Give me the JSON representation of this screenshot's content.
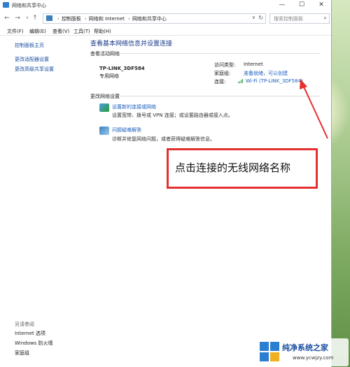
{
  "window": {
    "title": "网络和共享中心"
  },
  "controls": {
    "minimize": "—",
    "maximize": "☐",
    "close": "✕"
  },
  "nav": {
    "back": "←",
    "forward": "→",
    "recent": "∨",
    "up": "↑"
  },
  "address": {
    "crumbs": [
      "控制面板",
      "网络和 Internet",
      "网络和共享中心"
    ],
    "search_placeholder": "搜索控制面板"
  },
  "menu": [
    "文件(F)",
    "编辑(E)",
    "查看(V)",
    "工具(T)",
    "帮助(H)"
  ],
  "sidebar": {
    "links": [
      "控制面板主页",
      "更改适配器设置",
      "更改高级共享设置"
    ],
    "see_also_title": "另请参阅",
    "see_also": [
      "Internet 选项",
      "Windows 防火墙",
      "家庭组"
    ]
  },
  "main": {
    "heading": "查看基本网络信息并设置连接",
    "active_title": "查看活动网络",
    "network_name": "TP-LINK_3DF584",
    "network_type": "专用网络",
    "access_type_label": "访问类型:",
    "access_type_value": "Internet",
    "homegroup_label": "家庭组:",
    "homegroup_value": "准备就绪，可以创建",
    "connections_label": "连接:",
    "connections_value": "Wi-Fi (TP-LINK_3DF584)",
    "change_title": "更改网络设置",
    "tasks": [
      {
        "link": "设置新的连接或网络",
        "desc": "设置宽带、拨号或 VPN 连接；或设置路由器或接入点。"
      },
      {
        "link": "问题疑难解答",
        "desc": "诊断并修复网络问题，或者获得疑难解答信息。"
      }
    ]
  },
  "callout": {
    "text": "点击连接的无线网络名称"
  },
  "watermark": {
    "title": "纯净系统之家",
    "url": "www.ycwjzy.com"
  },
  "colors": {
    "link": "#1a5fbf",
    "callout_border": "#e53030",
    "wifi": "#2b9a3a"
  }
}
